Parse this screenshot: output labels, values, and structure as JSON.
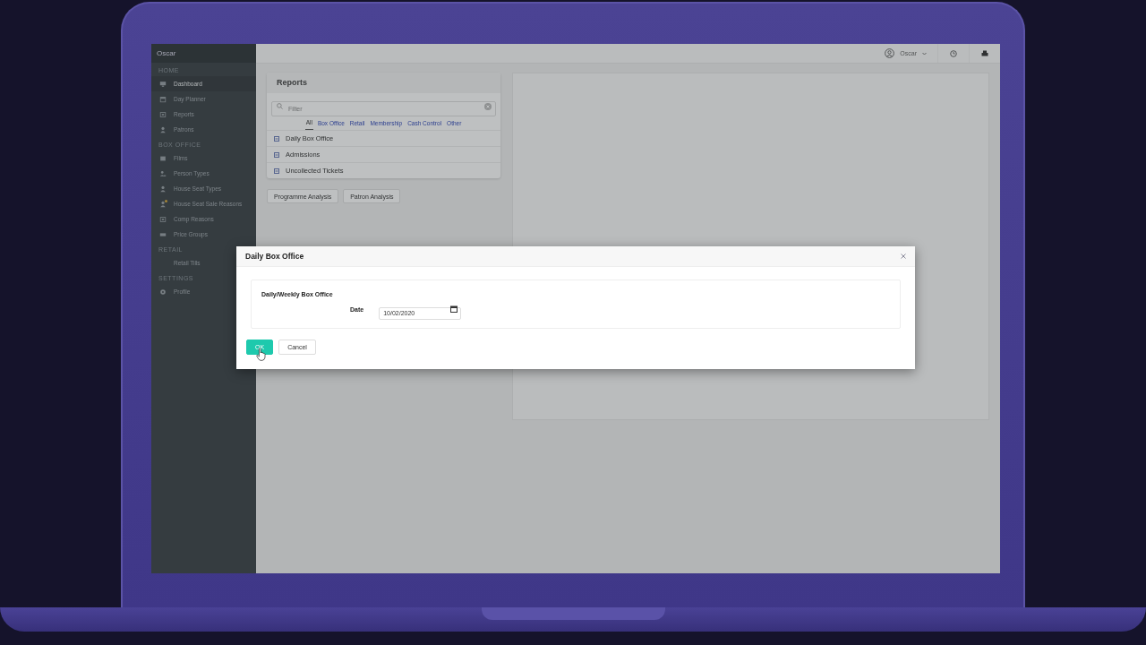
{
  "sidebar": {
    "title": "Oscar",
    "sections": [
      {
        "heading": "HOME",
        "items": [
          {
            "label": "Dashboard",
            "selected": true,
            "notification": false
          },
          {
            "label": "Day Planner",
            "selected": false,
            "notification": false
          },
          {
            "label": "Reports",
            "selected": false,
            "notification": false
          },
          {
            "label": "Patrons",
            "selected": false,
            "notification": false
          }
        ]
      },
      {
        "heading": "BOX OFFICE",
        "items": [
          {
            "label": "Films",
            "selected": false,
            "notification": false
          },
          {
            "label": "Person Types",
            "selected": false,
            "notification": false
          },
          {
            "label": "House Seat Types",
            "selected": false,
            "notification": false
          },
          {
            "label": "House Seat Sale Reasons",
            "selected": false,
            "notification": true
          },
          {
            "label": "Comp Reasons",
            "selected": false,
            "notification": false
          },
          {
            "label": "Price Groups",
            "selected": false,
            "notification": false
          }
        ]
      },
      {
        "heading": "RETAIL",
        "items": [
          {
            "label": "Retail Tills",
            "selected": false,
            "notification": false
          }
        ]
      },
      {
        "heading": "SETTINGS",
        "items": [
          {
            "label": "Profile",
            "selected": false,
            "notification": false
          }
        ]
      }
    ]
  },
  "topbar": {
    "user": "Oscar"
  },
  "reports": {
    "title": "Reports",
    "filter": {
      "placeholder": "Filter"
    },
    "tabs": [
      {
        "label": "All",
        "selected": true
      },
      {
        "label": "Box Office",
        "selected": false
      },
      {
        "label": "Retail",
        "selected": false
      },
      {
        "label": "Membership",
        "selected": false
      },
      {
        "label": "Cash Control",
        "selected": false
      },
      {
        "label": "Other",
        "selected": false
      }
    ],
    "items": [
      "Daily Box Office",
      "Admissions",
      "Uncollected Tickets"
    ]
  },
  "buttons": [
    "Programme Analysis",
    "Patron Analysis"
  ],
  "modal": {
    "title": "Daily Box Office",
    "section_label": "Daily/Weekly Box Office",
    "date_label": "Date",
    "date_value": "10/02/2020",
    "buttons": [
      {
        "label": "OK",
        "kind": "primary"
      },
      {
        "label": "Cancel",
        "kind": "default"
      }
    ]
  }
}
